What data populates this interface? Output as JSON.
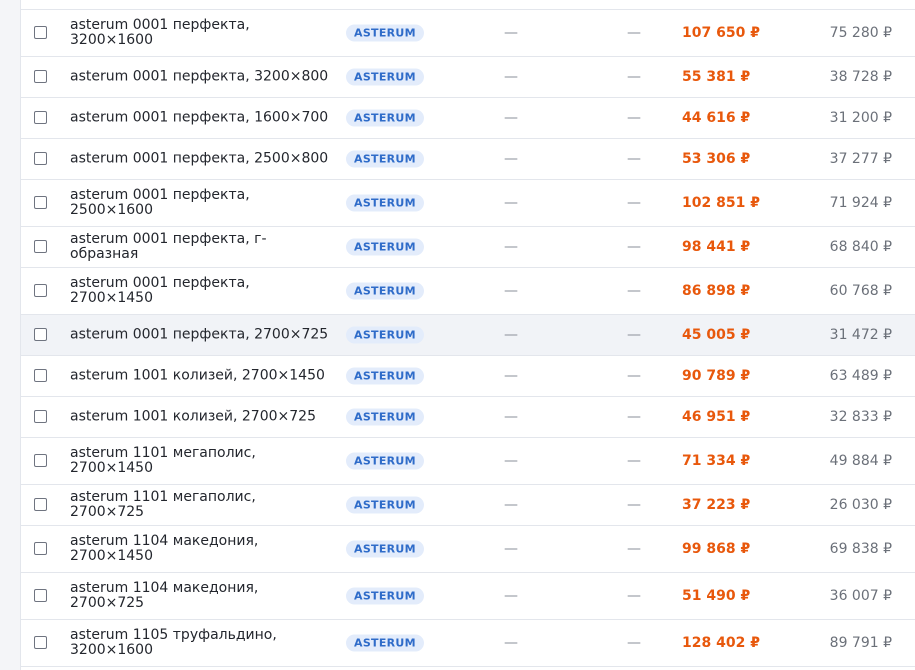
{
  "badge_label": "ASTERUM",
  "dash": "—",
  "rows": [
    {
      "name": "asterum 0001 перфекта, 3200×1600",
      "price": "107 650 ₽",
      "cost": "75 280 ₽"
    },
    {
      "name": "asterum 0001 перфекта, 3200×800",
      "price": "55 381 ₽",
      "cost": "38 728 ₽"
    },
    {
      "name": "asterum 0001 перфекта, 1600×700",
      "price": "44 616 ₽",
      "cost": "31 200 ₽"
    },
    {
      "name": "asterum 0001 перфекта, 2500×800",
      "price": "53 306 ₽",
      "cost": "37 277 ₽"
    },
    {
      "name": "asterum 0001 перфекта, 2500×1600",
      "price": "102 851 ₽",
      "cost": "71 924 ₽"
    },
    {
      "name": "asterum 0001 перфекта, г-образная",
      "price": "98 441 ₽",
      "cost": "68 840 ₽"
    },
    {
      "name": "asterum 0001 перфекта, 2700×1450",
      "price": "86 898 ₽",
      "cost": "60 768 ₽"
    },
    {
      "name": "asterum 0001 перфекта, 2700×725",
      "price": "45 005 ₽",
      "cost": "31 472 ₽"
    },
    {
      "name": "asterum 1001 колизей, 2700×1450",
      "price": "90 789 ₽",
      "cost": "63 489 ₽"
    },
    {
      "name": "asterum 1001 колизей, 2700×725",
      "price": "46 951 ₽",
      "cost": "32 833 ₽"
    },
    {
      "name": "asterum 1101 мегаполис, 2700×1450",
      "price": "71 334 ₽",
      "cost": "49 884 ₽"
    },
    {
      "name": "asterum 1101 мегаполис, 2700×725",
      "price": "37 223 ₽",
      "cost": "26 030 ₽"
    },
    {
      "name": "asterum 1104 македония, 2700×1450",
      "price": "99 868 ₽",
      "cost": "69 838 ₽"
    },
    {
      "name": "asterum 1104 македония, 2700×725",
      "price": "51 490 ₽",
      "cost": "36 007 ₽"
    },
    {
      "name": "asterum 1105 труфальдино, 3200×1600",
      "price": "128 402 ₽",
      "cost": "89 791 ₽"
    }
  ]
}
